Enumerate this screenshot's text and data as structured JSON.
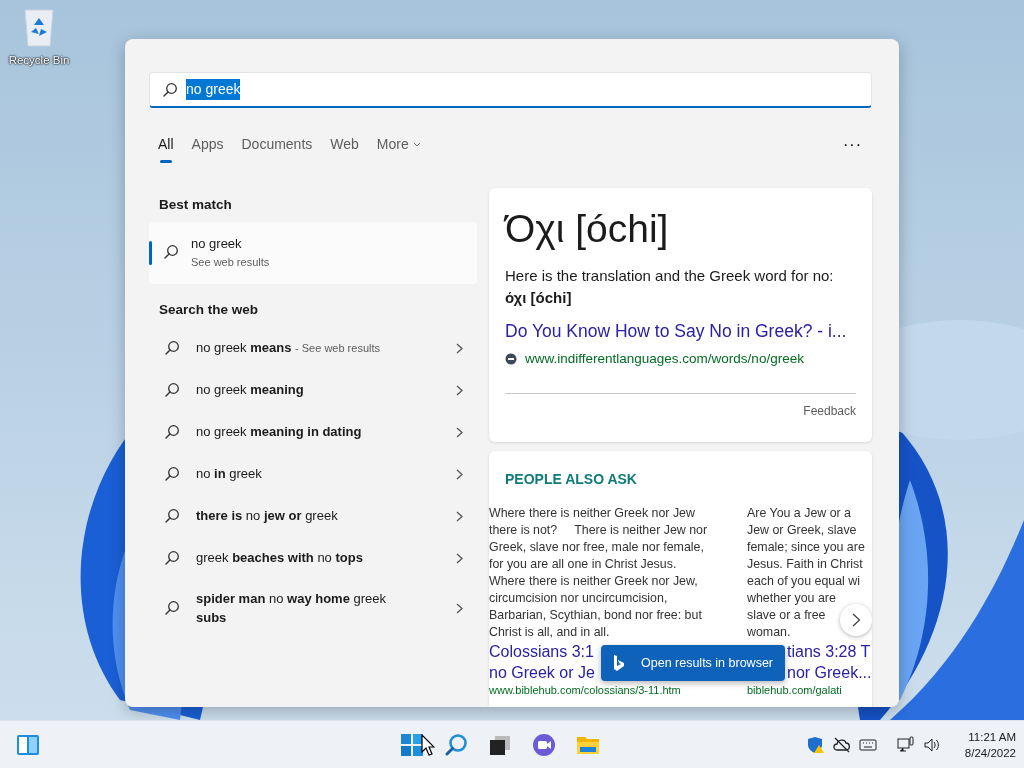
{
  "desktop": {
    "icons": [
      {
        "label": "Recycle Bin"
      }
    ]
  },
  "search": {
    "query": "no greek",
    "selected": true
  },
  "tabs": [
    {
      "label": "All",
      "selected": true
    },
    {
      "label": "Apps",
      "selected": false
    },
    {
      "label": "Documents",
      "selected": false
    },
    {
      "label": "Web",
      "selected": false
    },
    {
      "label": "More",
      "selected": false,
      "dropdown": true
    }
  ],
  "options_button": "···",
  "best_match": {
    "heading": "Best match",
    "title": "no greek",
    "subtitle": "See web results",
    "selected": true
  },
  "web_section": {
    "heading": "Search the web",
    "suggestions": [
      {
        "text": "no greek **means**",
        "note": "- See web results"
      },
      {
        "text": "no greek **meaning**"
      },
      {
        "text": "no greek **meaning in dating**"
      },
      {
        "text": "no **in** greek"
      },
      {
        "text": "**there is** no **jew or** greek"
      },
      {
        "text": "greek **beaches with** no **tops**"
      },
      {
        "text": "**spider man** no **way home** greek **subs**"
      }
    ]
  },
  "answer_card": {
    "title": "Όχι [óchi]",
    "text": "Here is the translation and the Greek word for no:",
    "answer": "όχι [óchi]",
    "link_title": "Do You Know How to Say No in Greek? - i...",
    "url": "www.indifferentlanguages.com/words/no/greek",
    "feedback": "Feedback"
  },
  "people_also_ask": {
    "heading": "PEOPLE ALSO ASK",
    "items": [
      {
        "lines": [
          "Where there is neither Greek nor Jew",
          "there is not?     There is neither Jew nor",
          "Greek, slave nor free, male nor female,",
          "for you are all one in Christ Jesus.",
          "Where there is neither Greek nor Jew,",
          "circumcision nor uncircumcision,",
          "Barbarian, Scythian, bond nor free: but",
          "Christ is all, and in all."
        ],
        "title_lines": [
          "Colossians 3:1",
          "no Greek or Je"
        ],
        "url": "www.biblehub.com/colossians/3-11.htm",
        "partly_hidden": false
      },
      {
        "lines": [
          "Are You a Jew or a",
          "Jew or Greek, slave",
          "female; since you are",
          "Jesus. Faith in Christ",
          "each of you equal wi",
          "whether you are",
          "slave or a free",
          "woman."
        ],
        "title_lines": [
          "tians 3:28 T",
          "nor Greek..."
        ],
        "url": "biblehub.com/galati",
        "partly_hidden": true
      }
    ]
  },
  "open_in_browser": "Open results in browser",
  "taskbar": {
    "time": "11:21 AM",
    "date": "8/24/2022"
  }
}
